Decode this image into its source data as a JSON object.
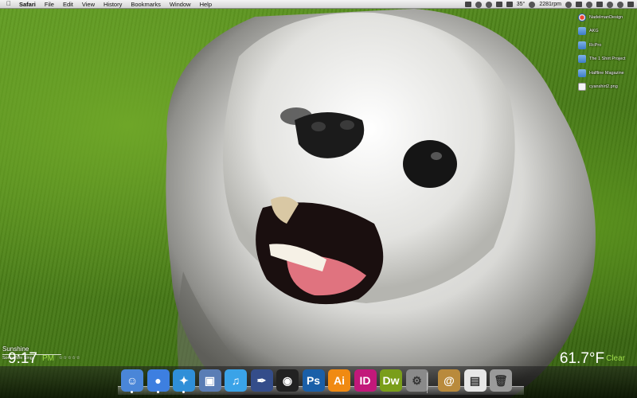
{
  "menubar": {
    "apple_icon": "apple-icon",
    "items": [
      "Safari",
      "File",
      "Edit",
      "View",
      "History",
      "Bookmarks",
      "Window",
      "Help"
    ],
    "status": {
      "temperature": "35°",
      "fan_speed": "2281rpm"
    }
  },
  "desktop_icons": [
    {
      "label": "NadelmanDesign",
      "icon": "app-icon"
    },
    {
      "label": "AKG",
      "icon": "folder-icon"
    },
    {
      "label": "RcPro",
      "icon": "folder-icon"
    },
    {
      "label": "The 1 Shirt Project",
      "icon": "folder-icon"
    },
    {
      "label": "Halfline Magazine",
      "icon": "folder-icon"
    },
    {
      "label": "cyanshirt2.png",
      "icon": "image-file-icon"
    }
  ],
  "now_playing": {
    "title": "Sunshine",
    "artist": "Songs We Sing",
    "rating": "☆☆☆☆☆"
  },
  "clock": {
    "time": "9:17",
    "ampm": "PM"
  },
  "weather": {
    "temp": "61.7°F",
    "condition": "Clear"
  },
  "dock": {
    "items": [
      {
        "name": "Finder",
        "icon": "finder-icon",
        "color": "#4a86d8",
        "glyph": "☺"
      },
      {
        "name": "iChat",
        "icon": "ichat-icon",
        "color": "#3d7fe0",
        "glyph": "●"
      },
      {
        "name": "Safari",
        "icon": "safari-icon",
        "color": "#2f8fd8",
        "glyph": "✦"
      },
      {
        "name": "Preview",
        "icon": "preview-icon",
        "color": "#5a7db5",
        "glyph": "▣"
      },
      {
        "name": "iTunes",
        "icon": "itunes-icon",
        "color": "#3aa3e8",
        "glyph": "♫"
      },
      {
        "name": "Pen Tool",
        "icon": "pen-icon",
        "color": "#344d8a",
        "glyph": "✒"
      },
      {
        "name": "Aperture",
        "icon": "aperture-icon",
        "color": "#222222",
        "glyph": "◉"
      },
      {
        "name": "Photoshop",
        "icon": "photoshop-icon",
        "color": "#1a5fa8",
        "glyph": "Ps"
      },
      {
        "name": "Illustrator",
        "icon": "illustrator-icon",
        "color": "#f08a12",
        "glyph": "Ai"
      },
      {
        "name": "InDesign",
        "icon": "indesign-icon",
        "color": "#c2187a",
        "glyph": "ID"
      },
      {
        "name": "Dreamweaver",
        "icon": "dreamweaver-icon",
        "color": "#7a9e1a",
        "glyph": "Dw"
      },
      {
        "name": "System Preferences",
        "icon": "gear-icon",
        "color": "#8a8a8a",
        "glyph": "⚙"
      },
      {
        "name": "Address Book",
        "icon": "address-book-icon",
        "color": "#b98a3c",
        "glyph": "@"
      },
      {
        "name": "Documents",
        "icon": "documents-icon",
        "color": "#e6e6e6",
        "glyph": "▤"
      },
      {
        "name": "Trash",
        "icon": "trash-icon",
        "color": "#9a9a9a",
        "glyph": "🗑"
      }
    ]
  }
}
